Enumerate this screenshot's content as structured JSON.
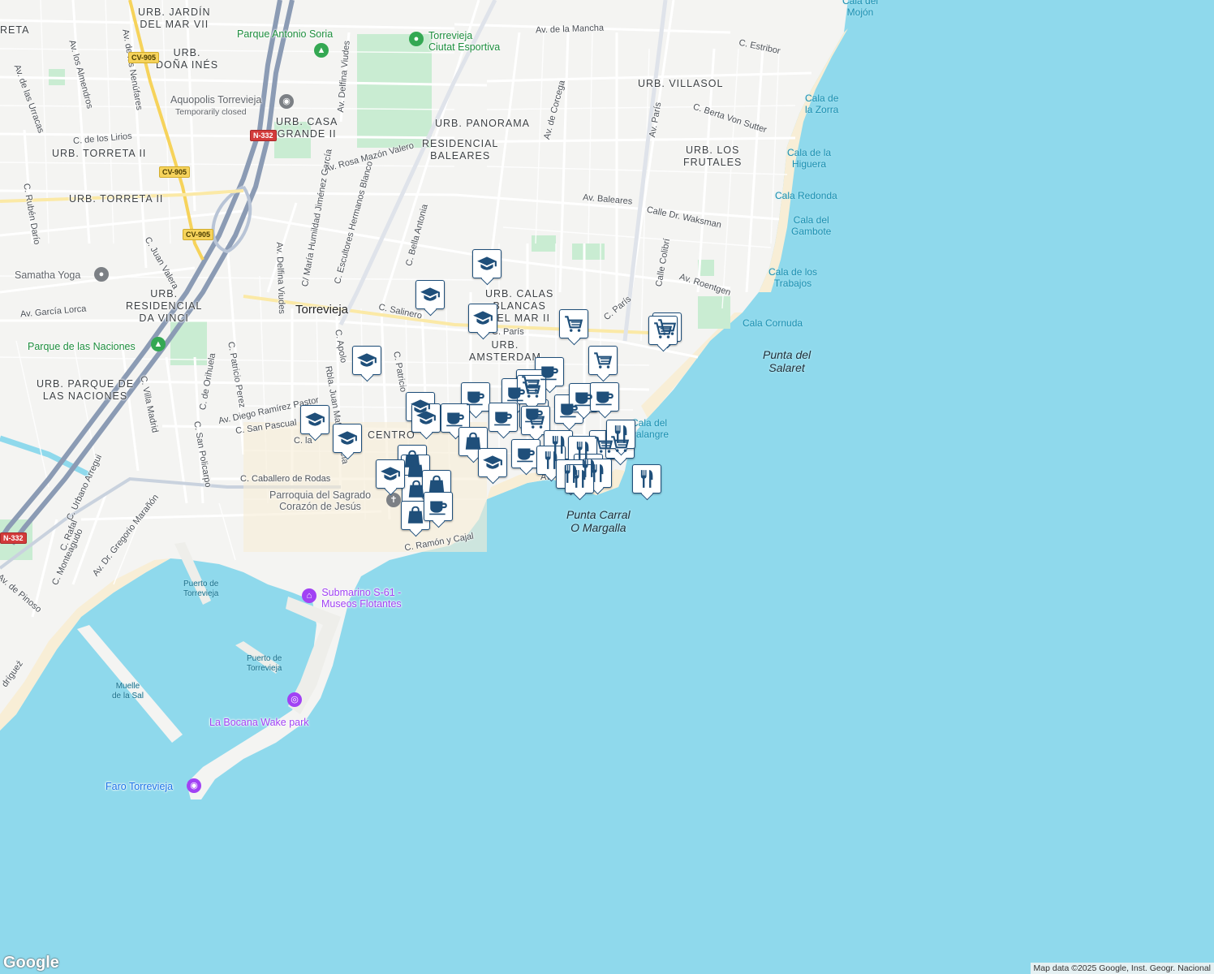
{
  "map": {
    "land_color": "#f4f4f2",
    "water_color": "#8fd9ec",
    "road_color": "#ffffff",
    "highway_color": "#8b9bb4",
    "beach_color": "#f8eed6",
    "park_color": "#c9ecd2"
  },
  "areas": {
    "jardin": "URB. JARDÍN\nDEL MAR VII",
    "doina": "URB.\nDOÑA INÉS",
    "casa_grande": "URB. CASA\nGRANDE II",
    "torreta2a": "URB. TORRETA II",
    "torreta2b": "URB. TORRETA II",
    "panorama": "URB. PANORAMA",
    "baleares": "RESIDENCIAL\nBALEARES",
    "villasol": "URB. VILLASOL",
    "frutales": "URB. LOS\nFRUTALES",
    "calas": "URB. CALAS\nBLANCAS\nDEL MAR II",
    "amsterdam": "URB.\nAMSTERDAM",
    "davinci": "URB.\nRESIDENCIAL\nDA VINCI",
    "naciones": "URB. PARQUE DE\nLAS NACIONES",
    "centro": "CENTRO",
    "reta": "RETA"
  },
  "city": "Torrevieja",
  "streets": {
    "mancha": "Av. de la Mancha",
    "estribor": "C. Estribor",
    "corcega": "Av. de Corcega",
    "paris_av": "Av. París",
    "berta": "C. Berta Von Sutter",
    "baleares_av": "Av. Baleares",
    "waksman": "Calle Dr. Waksman",
    "colibri": "Calle Colibrí",
    "roentgen": "Av. Roentgen",
    "c_paris": "C. París",
    "c_paris2": "C. París",
    "salinero": "C. Salinero",
    "bella": "C. Bella Antonia",
    "escultores": "C. Escultores Hermanos Blanco",
    "humildad": "C/ María Humildad Jiménez García",
    "viudes_top": "Av. Delfina Viudes",
    "viudes": "Av. Delfina Viudes",
    "rosa": "Av. Rosa Mazón Valero",
    "nenufares": "Av. de los Nenúfares",
    "almendros": "Av. los Almendros",
    "urracas": "Av. de las Urracas",
    "lirios": "C. de los Lirios",
    "ruben": "C. Rubén Darío",
    "valera": "C. Juan Valera",
    "lorca": "Av. García Lorca",
    "apolo": "C. Apolo",
    "patricio": "C. Patricio",
    "patricio_perez": "C. Patricio Perez",
    "orihuela": "C. de Orihuela",
    "villa_madrid": "C. Villa Madrid",
    "diego": "Av. Diego Ramírez Pastor",
    "san_pascual": "C. San Pascual",
    "rbla": "Rbla. Juan Mateo García",
    "c_la": "C. la",
    "policarpo": "C. San Policarpo",
    "caballero": "C. Caballero de Rodas",
    "urbano": "C. Urbano Arregui",
    "rafal": "C. Rafal",
    "montea": "C. Monteagudo",
    "maranon": "Av. Dr. Gregorio Marañón",
    "pinoso": "Av. de Pinoso",
    "ramon": "C. Ramón y Cajal",
    "rodriguez": "drígueź",
    "av_shore": "Av"
  },
  "shields": {
    "cv905a": "CV-905",
    "cv905b": "CV-905",
    "cv905c": "CV-905",
    "n332a": "N-332",
    "n332b": "N-332"
  },
  "pois": {
    "soria": "Parque Antonio Soria",
    "ciutat": "Torrevieja\nCiutat Esportiva",
    "aquopolis": "Aquopolis Torrevieja",
    "aquopolis_status": "Temporarily closed",
    "samatha": "Samatha Yoga",
    "naciones_park": "Parque de las Naciones",
    "parroquia": "Parroquia del Sagrado\nCorazón de Jesús",
    "submarino": "Submarino S-61 -\nMuseos Flotantes",
    "bocana": "La Bocana Wake park",
    "faro": "Faro Torrevieja",
    "puerto1": "Puerto de\nTorrevieja",
    "puerto2": "Puerto de\nTorrevieja",
    "muelle": "Muelle\nde la Sal"
  },
  "coast": {
    "mojon": "Cala del\nMojón",
    "zorra": "Cala de\nla Zorra",
    "higuera": "Cala de la\nHiguera",
    "redonda": "Cala Redonda",
    "gambote": "Cala del\nGambote",
    "trabajos": "Cala de los\nTrabajos",
    "cornuda": "Cala Cornuda",
    "salaret": "Punta del\nSalaret",
    "palangre": "Cala del\nPalangre",
    "carral": "Punta Carral\nO Margalla"
  },
  "markers": [
    {
      "type": "school"
    },
    {
      "type": "school"
    },
    {
      "type": "school"
    },
    {
      "type": "shop"
    },
    {
      "type": "school"
    },
    {
      "type": "cart"
    },
    {
      "type": "cart"
    },
    {
      "type": "cart"
    },
    {
      "type": "cafe"
    },
    {
      "type": "cart"
    },
    {
      "type": "cafe"
    },
    {
      "type": "cafe"
    },
    {
      "type": "cafe"
    },
    {
      "type": "cart"
    },
    {
      "type": "cafe"
    },
    {
      "type": "school"
    },
    {
      "type": "school"
    },
    {
      "type": "cafe"
    },
    {
      "type": "cafe"
    },
    {
      "type": "cart"
    },
    {
      "type": "cafe"
    },
    {
      "type": "cafe"
    },
    {
      "type": "school"
    },
    {
      "type": "school"
    },
    {
      "type": "bag"
    },
    {
      "type": "school"
    },
    {
      "type": "bag"
    },
    {
      "type": "bag"
    },
    {
      "type": "bag"
    },
    {
      "type": "bag"
    },
    {
      "type": "cafe"
    },
    {
      "type": "bag"
    },
    {
      "type": "cafe"
    },
    {
      "type": "cart"
    },
    {
      "type": "cart"
    },
    {
      "type": "food"
    },
    {
      "type": "food"
    },
    {
      "type": "food"
    },
    {
      "type": "food"
    },
    {
      "type": "food"
    },
    {
      "type": "food"
    },
    {
      "type": "food"
    },
    {
      "type": "food"
    },
    {
      "type": "food"
    },
    {
      "type": "school"
    }
  ],
  "attribution": "Map data ©2025 Google, Inst. Geogr. Nacional",
  "logo": "Google"
}
